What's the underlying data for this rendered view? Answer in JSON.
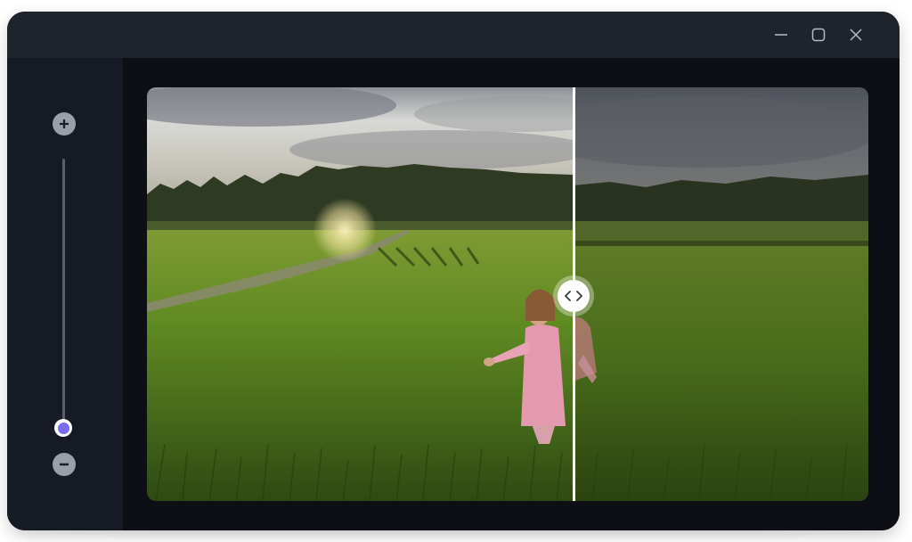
{
  "window": {
    "controls": [
      {
        "name": "minimize",
        "icon": "minimize-icon"
      },
      {
        "name": "maximize",
        "icon": "maximize-icon"
      },
      {
        "name": "close",
        "icon": "close-icon"
      }
    ]
  },
  "sidebar": {
    "zoom_in_icon": "plus-icon",
    "zoom_out_icon": "minus-icon",
    "zoom_slider": {
      "value": 0.0
    },
    "accent_color": "#7a6cf0"
  },
  "viewer": {
    "image_description_icon": "comparison-photo",
    "compare_handle_icon": "chevrons-left-right-icon",
    "compare_split": 0.58
  },
  "colors": {
    "titlebar": "#1f232c",
    "sidebar": "#161a24",
    "background": "#0d0f15"
  }
}
